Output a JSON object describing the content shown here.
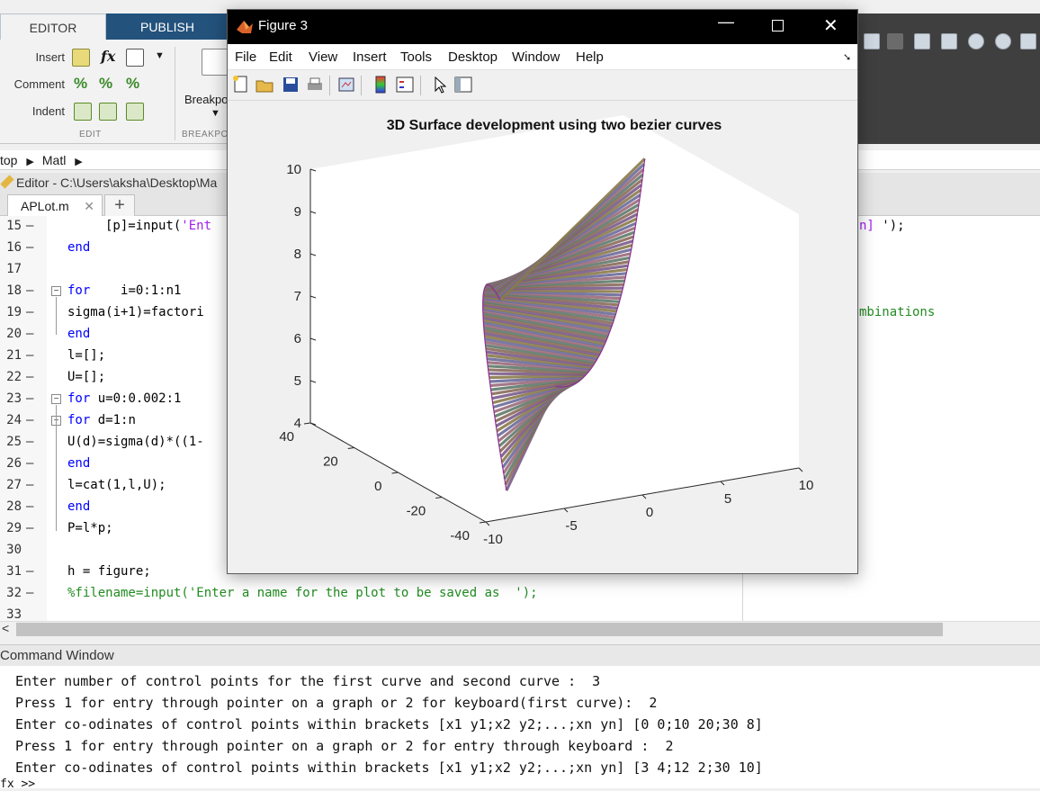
{
  "ribbon": {
    "tabs": [
      "EDITOR",
      "PUBLISH"
    ],
    "edit_group": {
      "insert": "Insert",
      "comment": "Comment",
      "indent": "Indent",
      "fx": "fx",
      "label": "EDIT"
    },
    "breakpoints": {
      "label": "Breakpo",
      "group": "BREAKPO"
    }
  },
  "breadcrumb": {
    "part1": "top",
    "part2": "Matl"
  },
  "editor": {
    "title": "Editor - C:\\Users\\aksha\\Desktop\\Ma",
    "file_tab": "APLot.m",
    "add_tab": "+",
    "line_numbers": [
      "15",
      "16",
      "17",
      "18",
      "19",
      "20",
      "21",
      "22",
      "23",
      "24",
      "25",
      "26",
      "27",
      "28",
      "29",
      "30",
      "31",
      "32",
      "33"
    ],
    "code": {
      "l15_a": "[p]=input(",
      "l15_b": "'Ent",
      "l15_right_a": "n]",
      "l15_right_b": " ');",
      "l16": "end",
      "l18_kw": "for",
      "l18_rest": "    i=0:1:n1",
      "l19": "sigma(i+1)=factori",
      "l19_right": "mbinations",
      "l20": "end",
      "l21": "l=[];",
      "l22": "U=[];",
      "l23_kw": "for",
      "l23_rest": " u=0:0.002:1",
      "l24_kw": "for",
      "l24_rest": " d=1:n",
      "l25": "U(d)=sigma(d)*((1-",
      "l26": "end",
      "l27": "l=cat(1,l,U);",
      "l28": "end",
      "l29": "P=l*p;",
      "l31": "h = figure;",
      "l32": "%filename=input('Enter a name for the plot to be saved as  ');"
    }
  },
  "command_window": {
    "title": "Command Window",
    "lines": [
      "Enter number of control points for the first curve and second curve :  3",
      "Press 1 for entry through pointer on a graph or 2 for keyboard(first curve):  2",
      "Enter co-odinates of control points within brackets [x1 y1;x2 y2;...;xn yn] [0 0;10 20;30 8]",
      "Press 1 for entry through pointer on a graph or 2 for entry through keyboard :  2",
      "Enter co-odinates of control points within brackets [x1 y1;x2 y2;...;xn yn] [3 4;12 2;30 10]"
    ],
    "prompt": "fx >>"
  },
  "figure": {
    "title": "Figure 3",
    "menu": [
      "File",
      "Edit",
      "View",
      "Insert",
      "Tools",
      "Desktop",
      "Window",
      "Help"
    ],
    "toolbar_icons": [
      "new-file-icon",
      "open-folder-icon",
      "save-icon",
      "print-icon",
      "link-plot-icon",
      "colorbar-icon",
      "legend-icon",
      "pointer-icon",
      "plot-tools-icon"
    ]
  },
  "chart_data": {
    "type": "surface",
    "title": "3D Surface development using two bezier curves",
    "xlabel": "",
    "ylabel": "",
    "zlabel": "",
    "x_ticks": [
      -10,
      -5,
      0,
      5,
      10
    ],
    "y_ticks": [
      -40,
      -20,
      0,
      20,
      40
    ],
    "z_ticks": [
      4,
      5,
      6,
      7,
      8,
      9,
      10
    ],
    "xlim": [
      -10,
      10
    ],
    "ylim": [
      -40,
      40
    ],
    "zlim": [
      4,
      10
    ],
    "grid": false
  }
}
